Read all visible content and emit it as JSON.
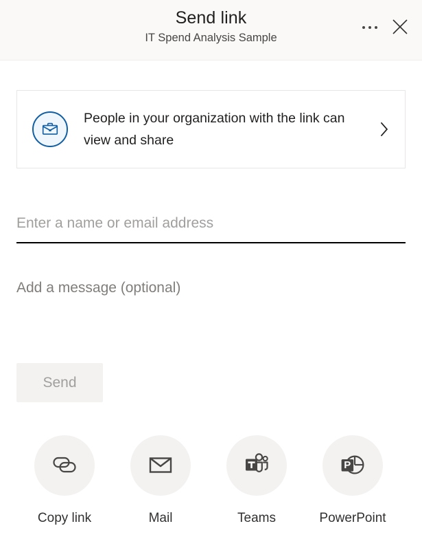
{
  "header": {
    "title": "Send link",
    "subtitle": "IT Spend Analysis Sample",
    "more_options_label": "More options",
    "close_label": "Close",
    "more_icon": "ellipsis-icon",
    "close_icon": "close-icon"
  },
  "permission": {
    "icon": "briefcase-icon",
    "text": "People in your organization with the link can view and share",
    "chevron_icon": "chevron-right-icon",
    "icon_border_color": "#115ea3",
    "icon_fill_color": "#eff6fc"
  },
  "recipients": {
    "placeholder": "Enter a name or email address",
    "value": ""
  },
  "message": {
    "placeholder": "Add a message (optional)",
    "value": ""
  },
  "send": {
    "label": "Send",
    "disabled": true,
    "background_color": "#f3f2f1",
    "text_color": "#a19f9d"
  },
  "actions": [
    {
      "label": "Copy link",
      "icon": "link-icon"
    },
    {
      "label": "Mail",
      "icon": "mail-icon"
    },
    {
      "label": "Teams",
      "icon": "teams-icon"
    },
    {
      "label": "PowerPoint",
      "icon": "powerpoint-icon"
    }
  ]
}
